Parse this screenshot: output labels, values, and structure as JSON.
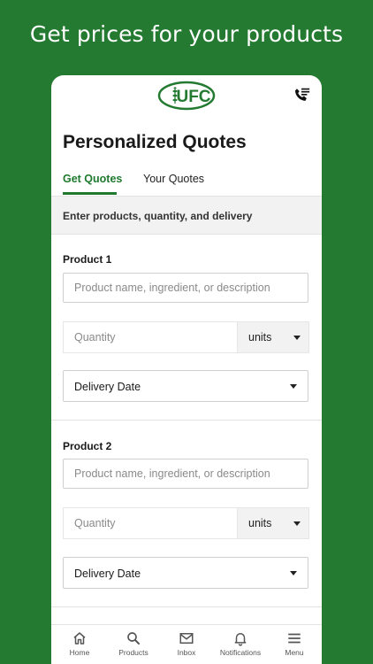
{
  "headline": "Get prices for your products",
  "header": {
    "logo_text": "UFC",
    "brand_color": "#257a32"
  },
  "page": {
    "title": "Personalized Quotes"
  },
  "tabs": [
    {
      "label": "Get Quotes",
      "active": true
    },
    {
      "label": "Your Quotes",
      "active": false
    }
  ],
  "section_header": "Enter products, quantity, and delivery",
  "products": [
    {
      "label": "Product 1",
      "name_placeholder": "Product name, ingredient, or description",
      "quantity_placeholder": "Quantity",
      "units_selected": "units",
      "delivery_selected": "Delivery Date"
    },
    {
      "label": "Product 2",
      "name_placeholder": "Product name, ingredient, or description",
      "quantity_placeholder": "Quantity",
      "units_selected": "units",
      "delivery_selected": "Delivery Date"
    }
  ],
  "bottom_nav": [
    {
      "label": "Home",
      "icon": "home-icon"
    },
    {
      "label": "Products",
      "icon": "search-icon"
    },
    {
      "label": "Inbox",
      "icon": "mail-icon"
    },
    {
      "label": "Notifications",
      "icon": "bell-icon"
    },
    {
      "label": "Menu",
      "icon": "menu-icon"
    }
  ]
}
